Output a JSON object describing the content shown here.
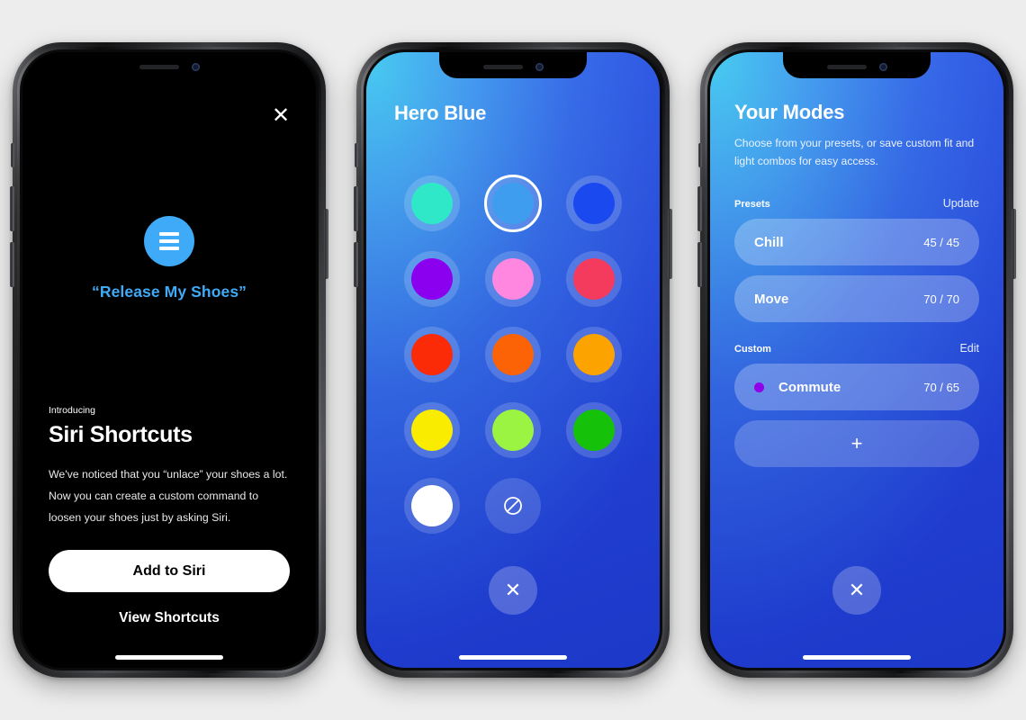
{
  "screen1": {
    "close_label": "✕",
    "siri_icon": "shortcuts-icon",
    "phrase": "“Release My Shoes”",
    "eyebrow": "Introducing",
    "title": "Siri Shortcuts",
    "paragraph": "We've noticed that you “unlace” your shoes a lot. Now you can create a custom command to loosen your shoes just by asking Siri.",
    "primary_button": "Add to Siri",
    "secondary_link": "View Shortcuts"
  },
  "screen2": {
    "title": "Hero Blue",
    "close_label": "✕",
    "swatches": [
      {
        "name": "turquoise",
        "color": "#2ee8c8",
        "selected": false
      },
      {
        "name": "sky-blue",
        "color": "#3f9df0",
        "selected": true
      },
      {
        "name": "royal-blue",
        "color": "#1b49f0",
        "selected": false
      },
      {
        "name": "violet",
        "color": "#8c00f0",
        "selected": false
      },
      {
        "name": "pink",
        "color": "#ff87e0",
        "selected": false
      },
      {
        "name": "crimson",
        "color": "#f43b5e",
        "selected": false
      },
      {
        "name": "red",
        "color": "#fa2b06",
        "selected": false
      },
      {
        "name": "orange",
        "color": "#fc6206",
        "selected": false
      },
      {
        "name": "amber",
        "color": "#fca300",
        "selected": false
      },
      {
        "name": "yellow",
        "color": "#f9ec00",
        "selected": false
      },
      {
        "name": "lime",
        "color": "#9bf342",
        "selected": false
      },
      {
        "name": "green",
        "color": "#16c109",
        "selected": false
      },
      {
        "name": "white",
        "color": "#ffffff",
        "selected": false
      }
    ],
    "lights_off_icon": "lights-off-icon"
  },
  "screen3": {
    "title": "Your Modes",
    "subtitle": "Choose from your presets, or save custom fit and light combos for easy access.",
    "close_label": "✕",
    "presets_section": {
      "label": "Presets",
      "action": "Update",
      "rows": [
        {
          "name": "Chill",
          "value": "45 / 45",
          "dot": null
        },
        {
          "name": "Move",
          "value": "70 / 70",
          "dot": null
        }
      ]
    },
    "custom_section": {
      "label": "Custom",
      "action": "Edit",
      "rows": [
        {
          "name": "Commute",
          "value": "70 / 65",
          "dot": "#8f00e8"
        }
      ],
      "add_label": "+"
    }
  },
  "theme": {
    "page_background": "#ededed",
    "accent_blue": "#3faaf7",
    "blue_gradient_start": "#3ec6f0",
    "blue_gradient_end": "#1f3fe0"
  }
}
